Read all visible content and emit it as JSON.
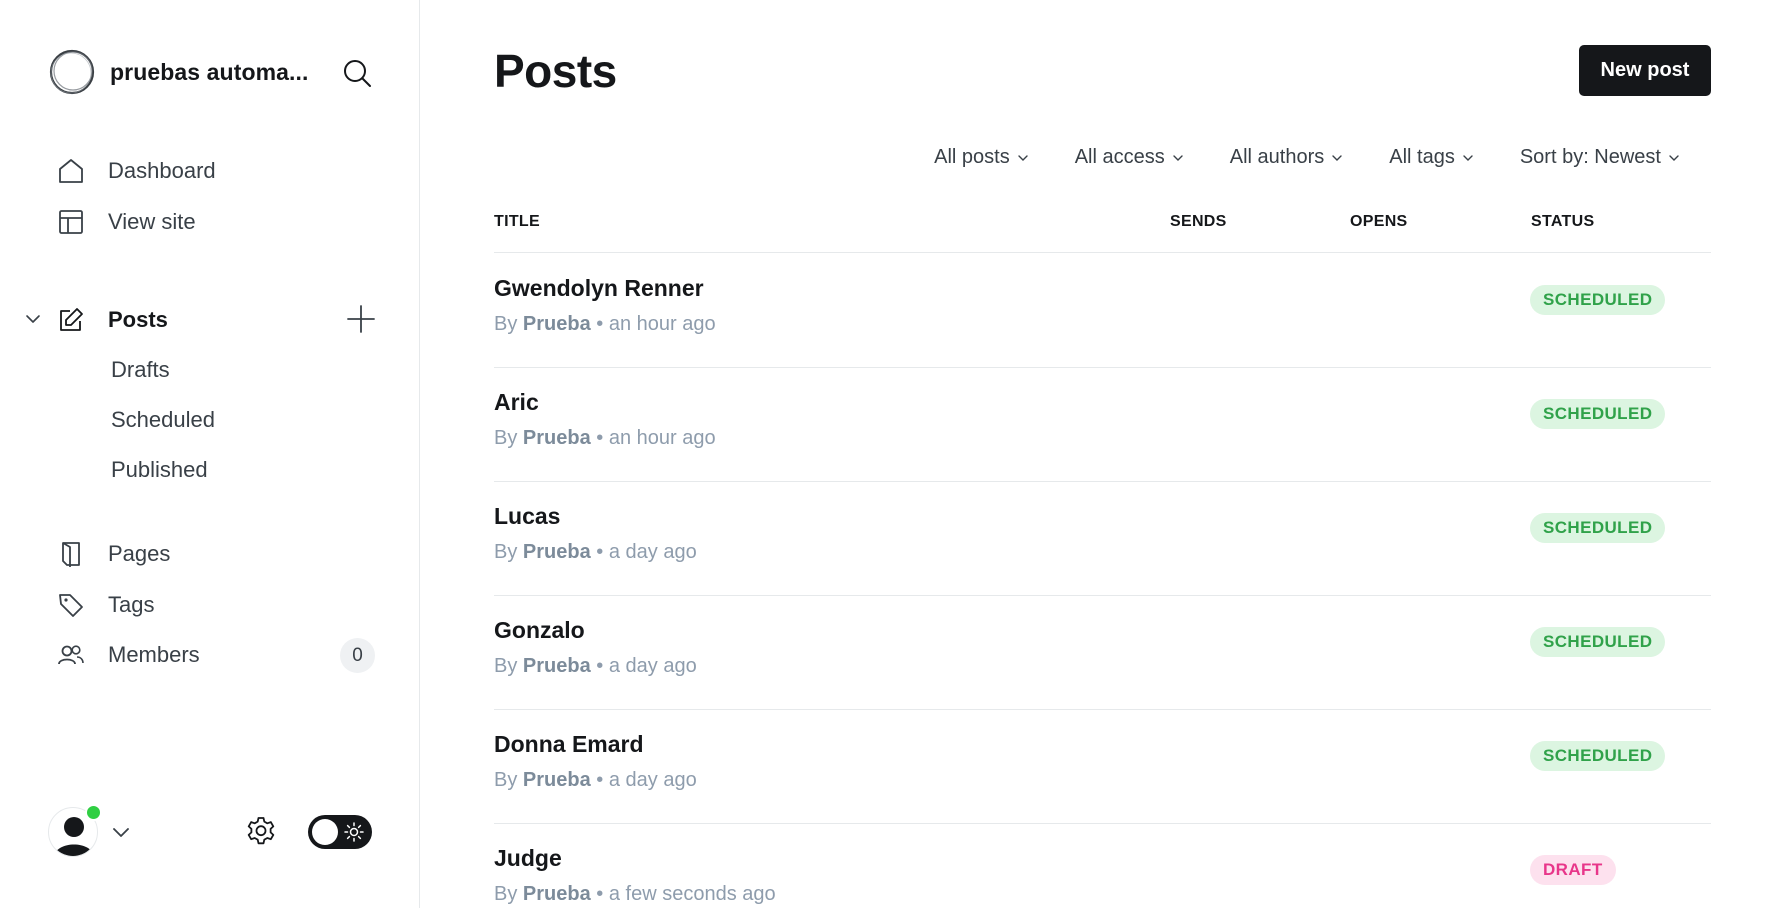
{
  "sidebar": {
    "site_name": "pruebas automa...",
    "nav": {
      "dashboard": "Dashboard",
      "view_site": "View site",
      "posts": "Posts",
      "pages": "Pages",
      "tags": "Tags",
      "members": "Members",
      "members_count": "0"
    },
    "posts_sub": {
      "drafts": "Drafts",
      "scheduled": "Scheduled",
      "published": "Published"
    },
    "icons": [
      "site-logo",
      "search-icon",
      "home-icon",
      "layout-icon",
      "chevron-down-icon",
      "pencil-square-icon",
      "plus-icon",
      "page-icon",
      "tag-icon",
      "members-icon",
      "user-avatar",
      "gear-icon",
      "sun-icon"
    ]
  },
  "header": {
    "title": "Posts",
    "new_post_label": "New post"
  },
  "filters": {
    "type": "All posts",
    "access": "All access",
    "authors": "All authors",
    "tags": "All tags",
    "sort": "Sort by: Newest"
  },
  "table": {
    "columns": {
      "title": "TITLE",
      "sends": "SENDS",
      "opens": "OPENS",
      "status": "STATUS"
    },
    "rows": [
      {
        "title": "Gwendolyn Renner",
        "by": "By",
        "author": "Prueba",
        "sep": "•",
        "time": "an hour ago",
        "status": "SCHEDULED"
      },
      {
        "title": "Aric",
        "by": "By",
        "author": "Prueba",
        "sep": "•",
        "time": "an hour ago",
        "status": "SCHEDULED"
      },
      {
        "title": "Lucas",
        "by": "By",
        "author": "Prueba",
        "sep": "•",
        "time": "a day ago",
        "status": "SCHEDULED"
      },
      {
        "title": "Gonzalo",
        "by": "By",
        "author": "Prueba",
        "sep": "•",
        "time": "a day ago",
        "status": "SCHEDULED"
      },
      {
        "title": "Donna Emard",
        "by": "By",
        "author": "Prueba",
        "sep": "•",
        "time": "a day ago",
        "status": "SCHEDULED"
      },
      {
        "title": "Judge",
        "by": "By",
        "author": "Prueba",
        "sep": "•",
        "time": "a few seconds ago",
        "status": "DRAFT"
      }
    ]
  },
  "colors": {
    "scheduled_text": "#30a24a",
    "scheduled_bg": "#dcf5e1",
    "draft_text": "#e8368a",
    "draft_bg": "#fde1ee",
    "online": "#30cf43",
    "primary_button": "#15171a"
  }
}
